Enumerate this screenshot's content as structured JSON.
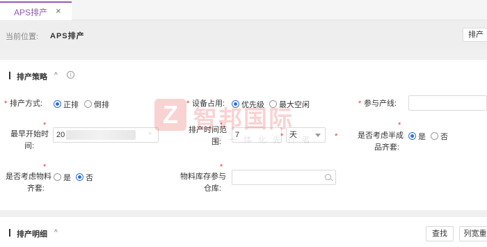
{
  "tab": {
    "label": "APS排产",
    "close": "×"
  },
  "breadcrumb": {
    "prefix": "当前位置:",
    "current": "APS排产",
    "button": "排产"
  },
  "strategy": {
    "title": "排产策略",
    "arrow": "^",
    "info": "i",
    "required_mark": "*",
    "mode": {
      "label": "排产方式:",
      "options": [
        "正排",
        "倒排"
      ],
      "selected": "正排"
    },
    "equipment": {
      "label": "设备占用:",
      "options": [
        "优先级",
        "最大空闲"
      ],
      "selected": "优先级"
    },
    "lines": {
      "label": "参与产线:",
      "value": ""
    },
    "earliest_start": {
      "label_line1": "最早开始时",
      "label_line2": "间:",
      "value": "20"
    },
    "range": {
      "label_line1": "排产时间范",
      "label_line2": "围:",
      "value": "7",
      "unit": "天"
    },
    "semi": {
      "label_line1": "是否考虑半成",
      "label_line2": "品齐套:",
      "options": [
        "是",
        "否"
      ],
      "selected": "是"
    },
    "material": {
      "label_line1": "是否考虑物料",
      "label_line2": "齐套:",
      "options": [
        "是",
        "否"
      ],
      "selected": "否"
    },
    "warehouse": {
      "label_line1": "物料库存参与",
      "label_line2": "仓库:",
      "value": ""
    }
  },
  "detail": {
    "title": "排产明细",
    "arrow": "^",
    "search_button": "查找",
    "column_button": "列宽重"
  },
  "watermark": {
    "logo_letter": "Z",
    "name": "智邦国际",
    "slogan": "智一体化先行者"
  },
  "colors": {
    "accent": "#2f6fd6",
    "tab_accent": "#9b59b6",
    "required": "#e53935"
  }
}
